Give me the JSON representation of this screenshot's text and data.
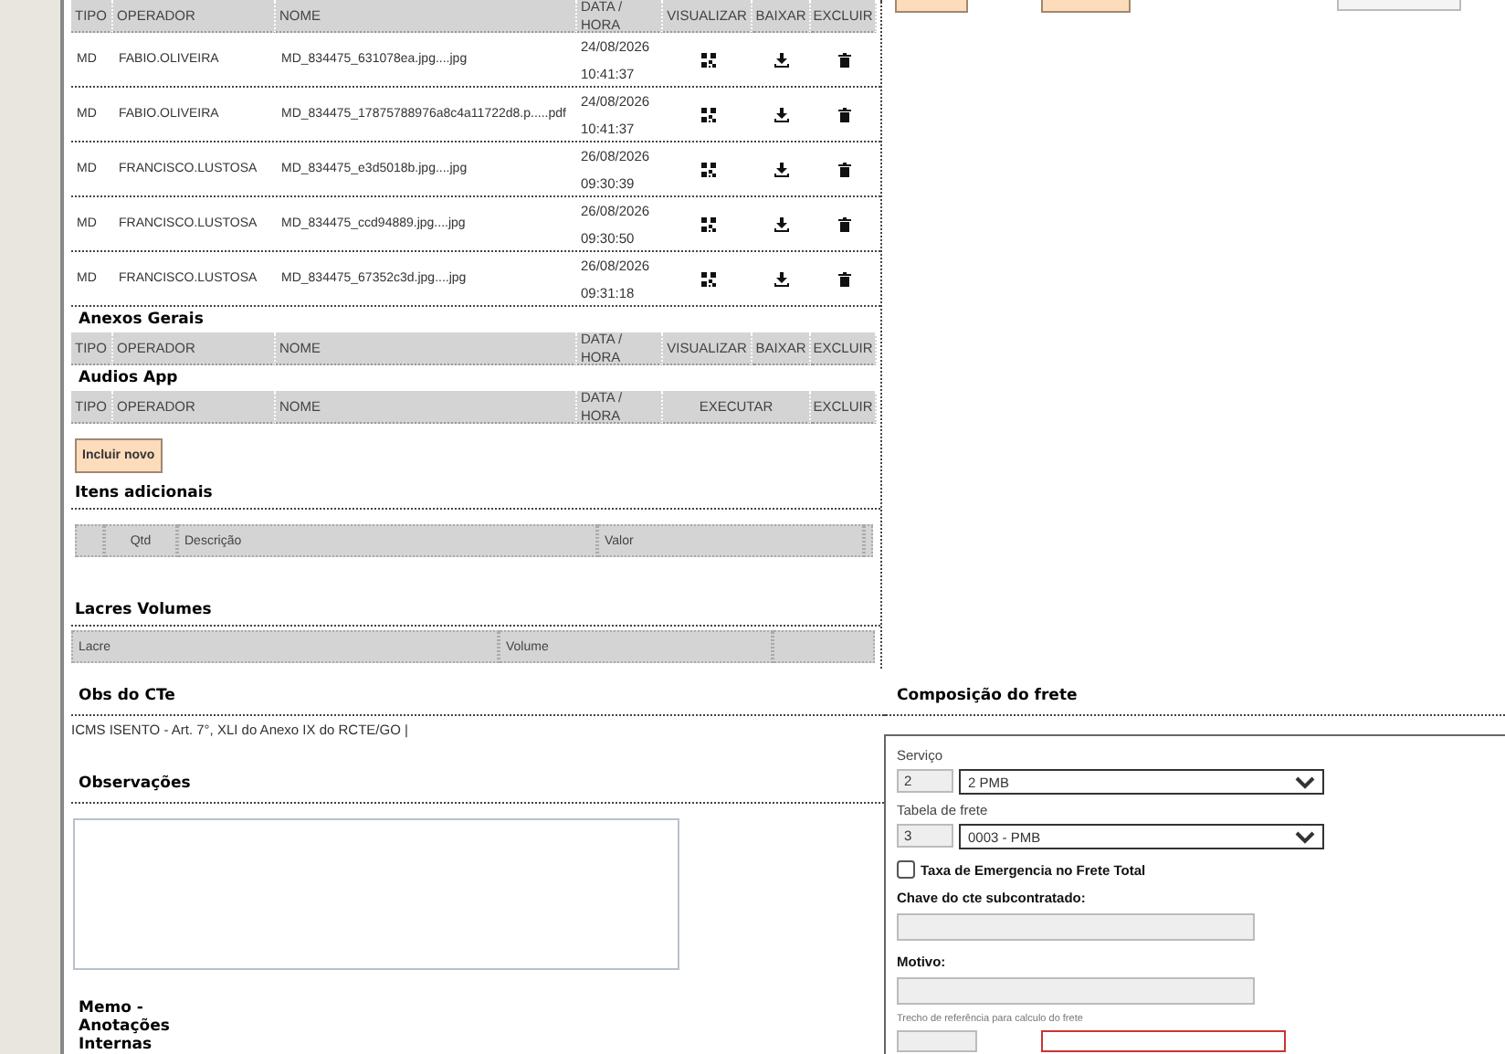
{
  "attachments": {
    "columns": [
      {
        "label": "TIPO"
      },
      {
        "label": "OPERADOR"
      },
      {
        "label": "NOME"
      },
      {
        "label": "DATA / HORA"
      },
      {
        "label": "VISUALIZAR"
      },
      {
        "label": "BAIXAR"
      },
      {
        "label": "EXCLUIR"
      }
    ],
    "rows": [
      {
        "tipo": "MD",
        "operador": "FABIO.OLIVEIRA",
        "nome": "MD_834475_631078ea.jpg....jpg",
        "data": "24/08/2026",
        "hora": "10:41:37"
      },
      {
        "tipo": "MD",
        "operador": "FABIO.OLIVEIRA",
        "nome": "MD_834475_17875788976a8c4a11722d8.p.....pdf",
        "data": "24/08/2026",
        "hora": "10:41:37"
      },
      {
        "tipo": "MD",
        "operador": "FRANCISCO.LUSTOSA",
        "nome": "MD_834475_e3d5018b.jpg....jpg",
        "data": "26/08/2026",
        "hora": "09:30:39"
      },
      {
        "tipo": "MD",
        "operador": "FRANCISCO.LUSTOSA",
        "nome": "MD_834475_ccd94889.jpg....jpg",
        "data": "26/08/2026",
        "hora": "09:30:50"
      },
      {
        "tipo": "MD",
        "operador": "FRANCISCO.LUSTOSA",
        "nome": "MD_834475_67352c3d.jpg....jpg",
        "data": "26/08/2026",
        "hora": "09:31:18"
      }
    ]
  },
  "anexos_gerais": {
    "title": "Anexos Gerais",
    "columns": [
      {
        "label": "TIPO"
      },
      {
        "label": "OPERADOR"
      },
      {
        "label": "NOME"
      },
      {
        "label": "DATA / HORA"
      },
      {
        "label": "VISUALIZAR"
      },
      {
        "label": "BAIXAR"
      },
      {
        "label": "EXCLUIR"
      }
    ]
  },
  "audios_app": {
    "title": "Audios App",
    "columns": [
      {
        "label": "TIPO"
      },
      {
        "label": "OPERADOR"
      },
      {
        "label": "NOME"
      },
      {
        "label": "DATA / HORA"
      },
      {
        "label": "EXECUTAR"
      },
      {
        "label": "EXCLUIR"
      }
    ]
  },
  "include_button": "Incluir novo",
  "itens_adicionais": {
    "title": "Itens adicionais",
    "columns": [
      "Qtd",
      "Descrição",
      "Valor"
    ]
  },
  "lacres_volumes": {
    "title": "Lacres Volumes",
    "columns": [
      "Lacre",
      "Volume"
    ]
  },
  "obs_cte": {
    "title": "Obs do CTe",
    "text": "ICMS ISENTO - Art. 7°, XLI do Anexo IX do RCTE/GO |"
  },
  "observacoes": {
    "title": "Observações"
  },
  "memo": {
    "title": "Memo - Anotações Internas"
  },
  "composicao_frete": {
    "title": "Composição do frete",
    "servico": {
      "label": "Serviço",
      "code": "2",
      "value": "2 PMB"
    },
    "tabela": {
      "label": "Tabela de frete",
      "code": "3",
      "value": "0003 - PMB"
    },
    "emergencia": {
      "label": "Taxa de Emergencia no Frete Total",
      "checked": false
    },
    "chave": {
      "label": "Chave do cte subcontratado:"
    },
    "motivo": {
      "label": "Motivo:"
    },
    "trecho": {
      "label": "Trecho de referência para calculo do frete"
    }
  }
}
